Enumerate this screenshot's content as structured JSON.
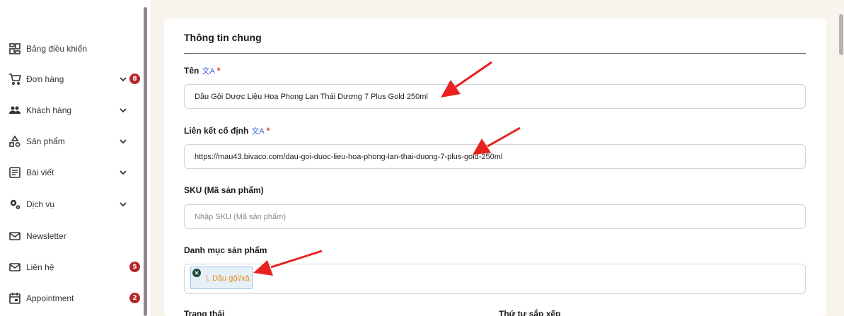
{
  "sidebar": {
    "items": [
      {
        "label": "Bảng điều khiển",
        "icon": "dashboard-icon"
      },
      {
        "label": "Đơn hàng",
        "icon": "cart-icon",
        "badge": "8"
      },
      {
        "label": "Khách hàng",
        "icon": "users-icon"
      },
      {
        "label": "Sản phẩm",
        "icon": "products-icon"
      },
      {
        "label": "Bài viết",
        "icon": "article-icon"
      },
      {
        "label": "Dịch vụ",
        "icon": "gears-icon"
      },
      {
        "label": "Newsletter",
        "icon": "mail-icon"
      },
      {
        "label": "Liên hệ",
        "icon": "mail-icon",
        "badge": "5"
      },
      {
        "label": "Appointment",
        "icon": "calendar-icon",
        "badge": "2"
      }
    ]
  },
  "form": {
    "section_title": "Thông tin chung",
    "name_label": "Tên",
    "name_value": "Dầu Gội Dược Liệu Hoa Phong Lan Thái Dương 7 Plus Gold 250ml",
    "slug_label": "Liên kết cố định",
    "slug_value": "https://mau43.bivaco.com/dau-goi-duoc-lieu-hoa-phong-lan-thai-duong-7-plus-gold-250ml",
    "sku_label": "SKU (Mã sản phẩm)",
    "sku_placeholder": "Nhập SKU (Mã sản phẩm)",
    "category_label": "Danh mục sản phẩm",
    "category_tag": "|, Dầu gội/xả",
    "required_mark": "*",
    "status_label": "Trạng thái",
    "order_label": "Thứ tự sắp xếp"
  },
  "colors": {
    "badge": "#b5262a",
    "page_background": "#f9f3ee",
    "annotation_arrow": "#e8201e",
    "tag_text": "#e88a1a"
  }
}
